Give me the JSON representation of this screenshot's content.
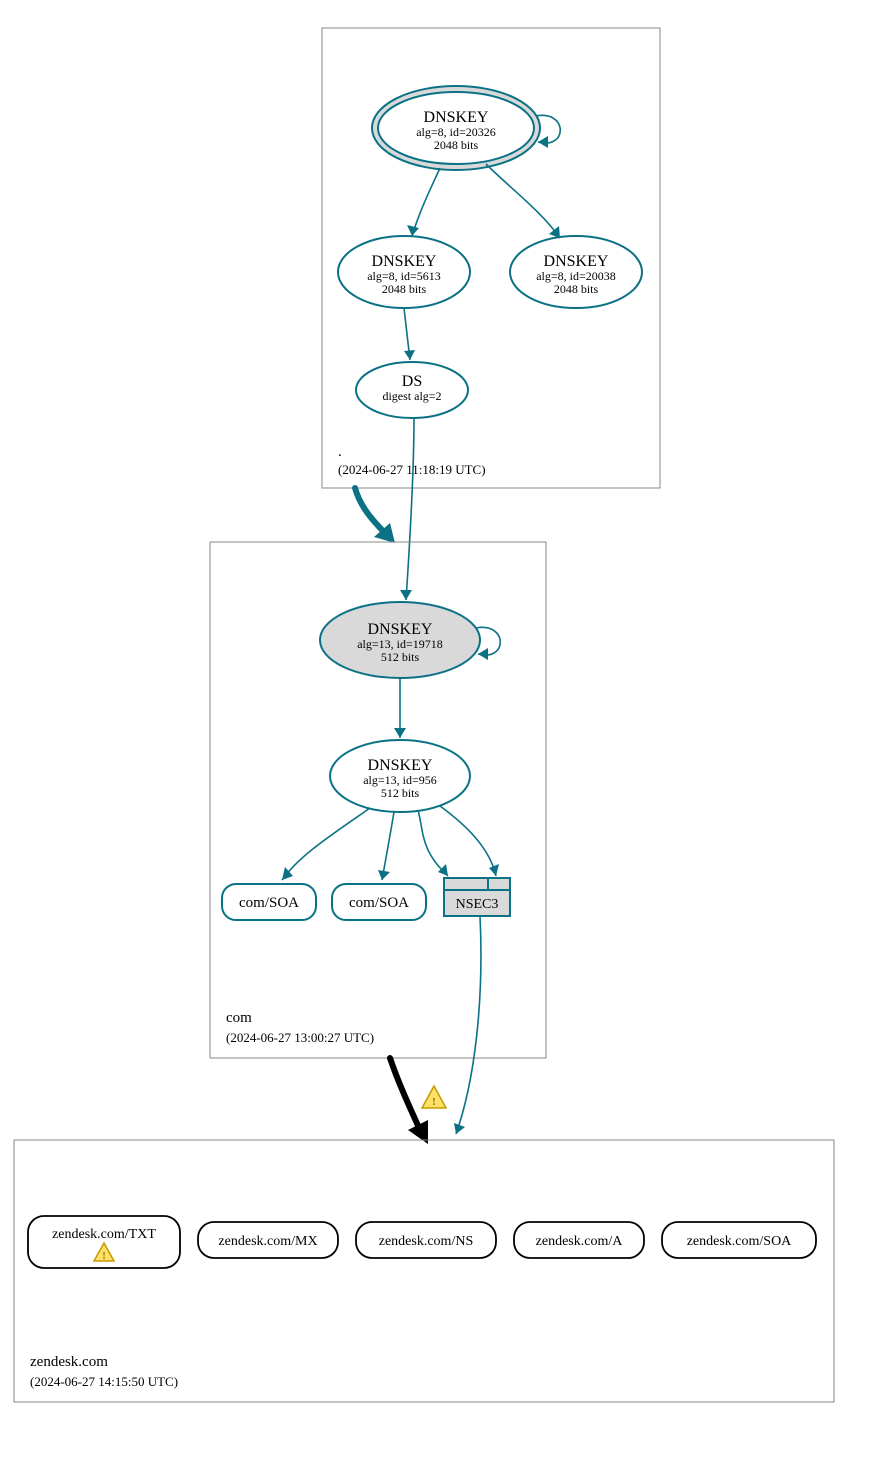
{
  "zones": {
    "root": {
      "label": ".",
      "timestamp": "(2024-06-27 11:18:19 UTC)"
    },
    "com": {
      "label": "com",
      "timestamp": "(2024-06-27 13:00:27 UTC)"
    },
    "leaf": {
      "label": "zendesk.com",
      "timestamp": "(2024-06-27 14:15:50 UTC)"
    }
  },
  "root": {
    "ksk": {
      "title": "DNSKEY",
      "line1": "alg=8, id=20326",
      "line2": "2048 bits"
    },
    "zsk1": {
      "title": "DNSKEY",
      "line1": "alg=8, id=5613",
      "line2": "2048 bits"
    },
    "zsk2": {
      "title": "DNSKEY",
      "line1": "alg=8, id=20038",
      "line2": "2048 bits"
    },
    "ds": {
      "title": "DS",
      "line1": "digest alg=2"
    }
  },
  "com": {
    "ksk": {
      "title": "DNSKEY",
      "line1": "alg=13, id=19718",
      "line2": "512 bits"
    },
    "zsk": {
      "title": "DNSKEY",
      "line1": "alg=13, id=956",
      "line2": "512 bits"
    },
    "soa1": "com/SOA",
    "soa2": "com/SOA",
    "nsec": "NSEC3"
  },
  "leaf": {
    "rr": [
      "zendesk.com/TXT",
      "zendesk.com/MX",
      "zendesk.com/NS",
      "zendesk.com/A",
      "zendesk.com/SOA"
    ]
  },
  "icons": {
    "warning": "⚠"
  }
}
